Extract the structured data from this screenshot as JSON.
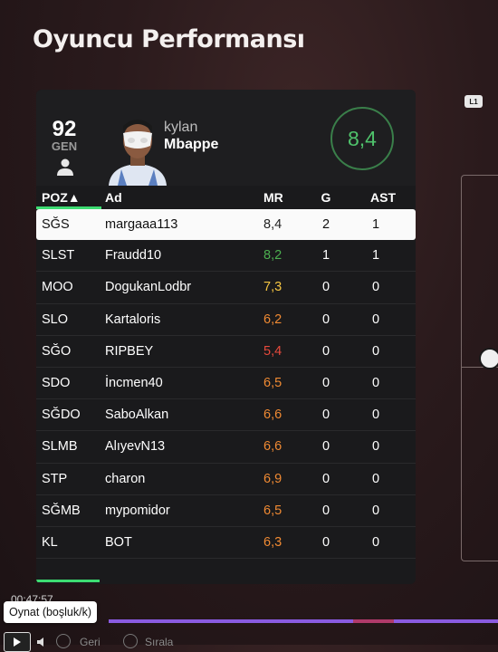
{
  "page": {
    "title": "Oyuncu Performansı"
  },
  "player": {
    "rating": "92",
    "rating_label": "GEN",
    "first_name": "kylan",
    "last_name": "Mbappe",
    "match_rating": "8,4"
  },
  "table": {
    "headers": {
      "pos": "POZ▲",
      "name": "Ad",
      "mr": "MR",
      "g": "G",
      "ast": "AST"
    },
    "rows": [
      {
        "pos": "SĞS",
        "name": "margaaa113",
        "mr": "8,4",
        "g": "2",
        "ast": "1",
        "mr_color": "#222222"
      },
      {
        "pos": "SLST",
        "name": "Fraudd10",
        "mr": "8,2",
        "g": "1",
        "ast": "1",
        "mr_color": "#4caf50"
      },
      {
        "pos": "MOO",
        "name": "DogukanLodbr",
        "mr": "7,3",
        "g": "0",
        "ast": "0",
        "mr_color": "#f5c542"
      },
      {
        "pos": "SLO",
        "name": "Kartaloris",
        "mr": "6,2",
        "g": "0",
        "ast": "0",
        "mr_color": "#f08a33"
      },
      {
        "pos": "SĞO",
        "name": "RIPBEY",
        "mr": "5,4",
        "g": "0",
        "ast": "0",
        "mr_color": "#e84a3c"
      },
      {
        "pos": "SDO",
        "name": "İncmen40",
        "mr": "6,5",
        "g": "0",
        "ast": "0",
        "mr_color": "#f08a33"
      },
      {
        "pos": "SĞDO",
        "name": "SaboAlkan",
        "mr": "6,6",
        "g": "0",
        "ast": "0",
        "mr_color": "#f08a33"
      },
      {
        "pos": "SLMB",
        "name": "AlıyevN13",
        "mr": "6,6",
        "g": "0",
        "ast": "0",
        "mr_color": "#f08a33"
      },
      {
        "pos": "STP",
        "name": "charon",
        "mr": "6,9",
        "g": "0",
        "ast": "0",
        "mr_color": "#f08a33"
      },
      {
        "pos": "SĞMB",
        "name": "mypomidor",
        "mr": "6,5",
        "g": "0",
        "ast": "0",
        "mr_color": "#f08a33"
      },
      {
        "pos": "KL",
        "name": "BOT",
        "mr": "6,3",
        "g": "0",
        "ast": "0",
        "mr_color": "#f08a33"
      }
    ]
  },
  "side": {
    "badge": "L1"
  },
  "player_controls": {
    "timestamp": "00:47:57",
    "tooltip": "Oynat (boşluk/k)",
    "back_label": "Geri",
    "sort_label": "Sırala"
  },
  "colors": {
    "accent": "#3ddc72",
    "rating_green": "#4fc26b",
    "progress": "#8a5be0"
  },
  "icons": [
    "person-icon",
    "play-icon",
    "volume-icon"
  ]
}
